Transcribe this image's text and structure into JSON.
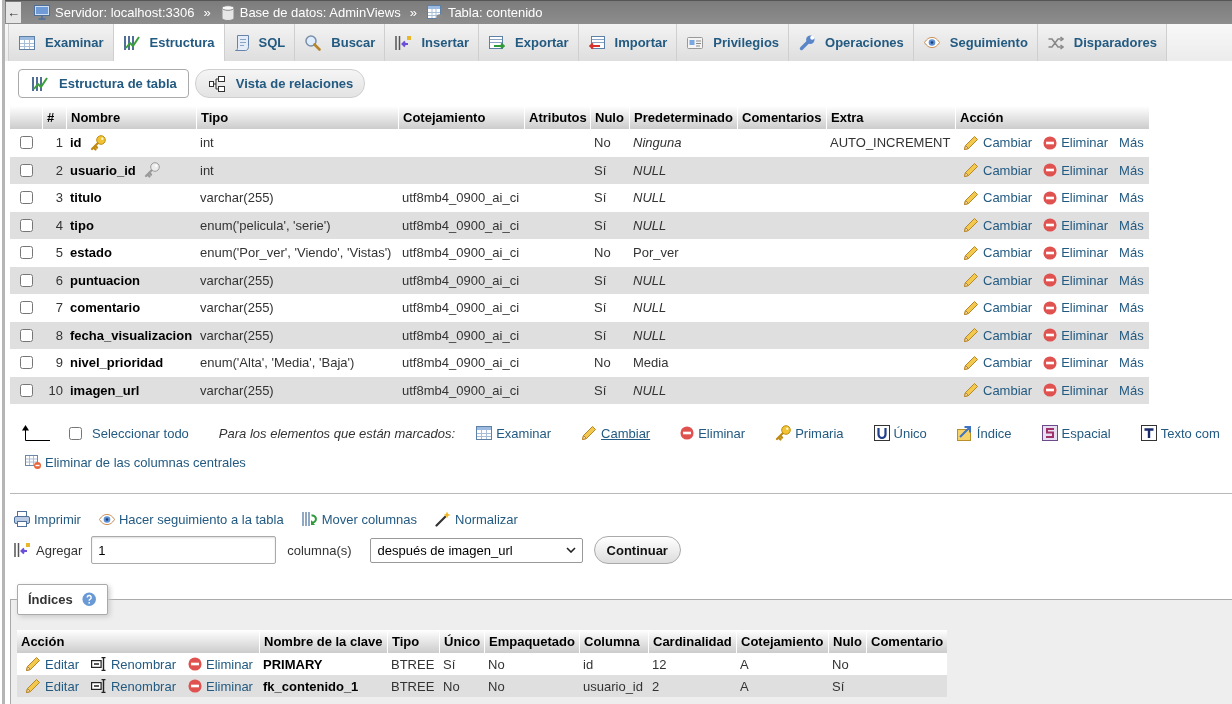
{
  "breadcrumb": {
    "back": "←",
    "items": [
      {
        "kind": "server",
        "label": "Servidor: localhost:3306"
      },
      {
        "kind": "separator",
        "label": "»"
      },
      {
        "kind": "database",
        "label": "Base de datos: AdminViews"
      },
      {
        "kind": "separator",
        "label": "»"
      },
      {
        "kind": "table",
        "label": "Tabla: contenido"
      }
    ]
  },
  "tabs": [
    {
      "kind": "browse",
      "label": "Examinar",
      "selected": false
    },
    {
      "kind": "structure",
      "label": "Estructura",
      "selected": true
    },
    {
      "kind": "sql",
      "label": "SQL",
      "selected": false
    },
    {
      "kind": "search",
      "label": "Buscar",
      "selected": false
    },
    {
      "kind": "insert",
      "label": "Insertar",
      "selected": false
    },
    {
      "kind": "export",
      "label": "Exportar",
      "selected": false
    },
    {
      "kind": "import",
      "label": "Importar",
      "selected": false
    },
    {
      "kind": "privileges",
      "label": "Privilegios",
      "selected": false
    },
    {
      "kind": "operations",
      "label": "Operaciones",
      "selected": false
    },
    {
      "kind": "tracking",
      "label": "Seguimiento",
      "selected": false
    },
    {
      "kind": "triggers",
      "label": "Disparadores",
      "selected": false
    }
  ],
  "subtabs": [
    {
      "kind": "structure",
      "label": "Estructura de tabla",
      "selected": true
    },
    {
      "kind": "relations",
      "label": "Vista de relaciones",
      "selected": false
    }
  ],
  "structure_table": {
    "columns": [
      "#",
      "Nombre",
      "Tipo",
      "Cotejamiento",
      "Atributos",
      "Nulo",
      "Predeterminado",
      "Comentarios",
      "Extra",
      "Acción"
    ],
    "rows": [
      {
        "checked": false,
        "number": "1",
        "name": "id",
        "primary_key": true,
        "index_key": false,
        "type": "int",
        "null": "No",
        "default": "Ninguna",
        "default_italic": true,
        "extra": "AUTO_INCREMENT",
        "actions": [
          {
            "kind": "change",
            "label": "Cambiar"
          },
          {
            "kind": "drop",
            "label": "Eliminar"
          },
          {
            "kind": "more",
            "label": "Más"
          }
        ]
      },
      {
        "checked": false,
        "number": "2",
        "name": "usuario_id",
        "primary_key": false,
        "index_key": true,
        "type": "int",
        "null": "Sí",
        "default": "NULL",
        "default_italic": true,
        "actions": [
          {
            "kind": "change",
            "label": "Cambiar"
          },
          {
            "kind": "drop",
            "label": "Eliminar"
          },
          {
            "kind": "more",
            "label": "Más"
          }
        ]
      },
      {
        "checked": false,
        "number": "3",
        "name": "titulo",
        "primary_key": false,
        "index_key": false,
        "type": "varchar(255)",
        "collation": "utf8mb4_0900_ai_ci",
        "null": "Sí",
        "default": "NULL",
        "default_italic": true,
        "actions": [
          {
            "kind": "change",
            "label": "Cambiar"
          },
          {
            "kind": "drop",
            "label": "Eliminar"
          },
          {
            "kind": "more",
            "label": "Más"
          }
        ]
      },
      {
        "checked": false,
        "number": "4",
        "name": "tipo",
        "primary_key": false,
        "index_key": false,
        "type": "enum('pelicula', 'serie')",
        "collation": "utf8mb4_0900_ai_ci",
        "null": "Sí",
        "default": "NULL",
        "default_italic": true,
        "actions": [
          {
            "kind": "change",
            "label": "Cambiar"
          },
          {
            "kind": "drop",
            "label": "Eliminar"
          },
          {
            "kind": "more",
            "label": "Más"
          }
        ]
      },
      {
        "checked": false,
        "number": "5",
        "name": "estado",
        "primary_key": false,
        "index_key": false,
        "type": "enum('Por_ver', 'Viendo', 'Vistas')",
        "collation": "utf8mb4_0900_ai_ci",
        "null": "No",
        "default": "Por_ver",
        "default_italic": false,
        "actions": [
          {
            "kind": "change",
            "label": "Cambiar"
          },
          {
            "kind": "drop",
            "label": "Eliminar"
          },
          {
            "kind": "more",
            "label": "Más"
          }
        ]
      },
      {
        "checked": false,
        "number": "6",
        "name": "puntuacion",
        "primary_key": false,
        "index_key": false,
        "type": "varchar(255)",
        "collation": "utf8mb4_0900_ai_ci",
        "null": "Sí",
        "default": "NULL",
        "default_italic": true,
        "actions": [
          {
            "kind": "change",
            "label": "Cambiar"
          },
          {
            "kind": "drop",
            "label": "Eliminar"
          },
          {
            "kind": "more",
            "label": "Más"
          }
        ]
      },
      {
        "checked": false,
        "number": "7",
        "name": "comentario",
        "primary_key": false,
        "index_key": false,
        "type": "varchar(255)",
        "collation": "utf8mb4_0900_ai_ci",
        "null": "Sí",
        "default": "NULL",
        "default_italic": true,
        "actions": [
          {
            "kind": "change",
            "label": "Cambiar"
          },
          {
            "kind": "drop",
            "label": "Eliminar"
          },
          {
            "kind": "more",
            "label": "Más"
          }
        ]
      },
      {
        "checked": false,
        "number": "8",
        "name": "fecha_visualizacion",
        "primary_key": false,
        "index_key": false,
        "type": "varchar(255)",
        "collation": "utf8mb4_0900_ai_ci",
        "null": "Sí",
        "default": "NULL",
        "default_italic": true,
        "actions": [
          {
            "kind": "change",
            "label": "Cambiar"
          },
          {
            "kind": "drop",
            "label": "Eliminar"
          },
          {
            "kind": "more",
            "label": "Más"
          }
        ]
      },
      {
        "checked": false,
        "number": "9",
        "name": "nivel_prioridad",
        "primary_key": false,
        "index_key": false,
        "type": "enum('Alta', 'Media', 'Baja')",
        "collation": "utf8mb4_0900_ai_ci",
        "null": "No",
        "default": "Media",
        "default_italic": false,
        "actions": [
          {
            "kind": "change",
            "label": "Cambiar"
          },
          {
            "kind": "drop",
            "label": "Eliminar"
          },
          {
            "kind": "more",
            "label": "Más"
          }
        ]
      },
      {
        "checked": false,
        "number": "10",
        "name": "imagen_url",
        "primary_key": false,
        "index_key": false,
        "type": "varchar(255)",
        "collation": "utf8mb4_0900_ai_ci",
        "null": "Sí",
        "default": "NULL",
        "default_italic": true,
        "actions": [
          {
            "kind": "change",
            "label": "Cambiar"
          },
          {
            "kind": "drop",
            "label": "Eliminar"
          },
          {
            "kind": "more",
            "label": "Más"
          }
        ]
      }
    ]
  },
  "bulk_actions": {
    "select_all": {
      "label": "Seleccionar todo",
      "checked": false
    },
    "caption": "Para los elementos que están marcados:",
    "items": [
      {
        "kind": "browse",
        "label": "Examinar",
        "hovered": false
      },
      {
        "kind": "change",
        "label": "Cambiar",
        "hovered": true
      },
      {
        "kind": "drop",
        "label": "Eliminar",
        "hovered": false
      },
      {
        "kind": "primary",
        "label": "Primaria",
        "hovered": false
      },
      {
        "kind": "unique",
        "label": "Único",
        "hovered": false
      },
      {
        "kind": "index",
        "label": "Índice",
        "hovered": false
      },
      {
        "kind": "spatial",
        "label": "Espacial",
        "hovered": false
      },
      {
        "kind": "fulltext",
        "label": "Texto com",
        "hovered": false
      }
    ],
    "central": "Eliminar de las columnas centrales"
  },
  "tools": [
    {
      "kind": "print",
      "label": "Imprimir"
    },
    {
      "kind": "track",
      "label": "Hacer seguimiento a la tabla"
    },
    {
      "kind": "move",
      "label": "Mover columnas"
    },
    {
      "kind": "normalize",
      "label": "Normalizar"
    }
  ],
  "add_columns": {
    "label": "Agregar",
    "value": "1",
    "unit": "columna(s)",
    "position": "después de imagen_url",
    "button": "Continuar"
  },
  "indexes": {
    "legend": "Índices",
    "columns": [
      "Acción",
      "Nombre de la clave",
      "Tipo",
      "Único",
      "Empaquetado",
      "Columna",
      "Cardinalidad",
      "Cotejamiento",
      "Nulo",
      "Comentario"
    ],
    "rows": [
      {
        "actions": [
          {
            "kind": "edit",
            "label": "Editar"
          },
          {
            "kind": "rename",
            "label": "Renombrar"
          },
          {
            "kind": "drop",
            "label": "Eliminar"
          }
        ],
        "key_name": "PRIMARY",
        "type": "BTREE",
        "unique": "Sí",
        "packed": "No",
        "column": "id",
        "cardinality": "12",
        "collation": "A",
        "null": "No"
      },
      {
        "actions": [
          {
            "kind": "edit",
            "label": "Editar"
          },
          {
            "kind": "rename",
            "label": "Renombrar"
          },
          {
            "kind": "drop",
            "label": "Eliminar"
          }
        ],
        "key_name": "fk_contenido_1",
        "type": "BTREE",
        "unique": "No",
        "packed": "No",
        "column": "usuario_id",
        "cardinality": "2",
        "collation": "A",
        "null": "Sí"
      }
    ]
  }
}
